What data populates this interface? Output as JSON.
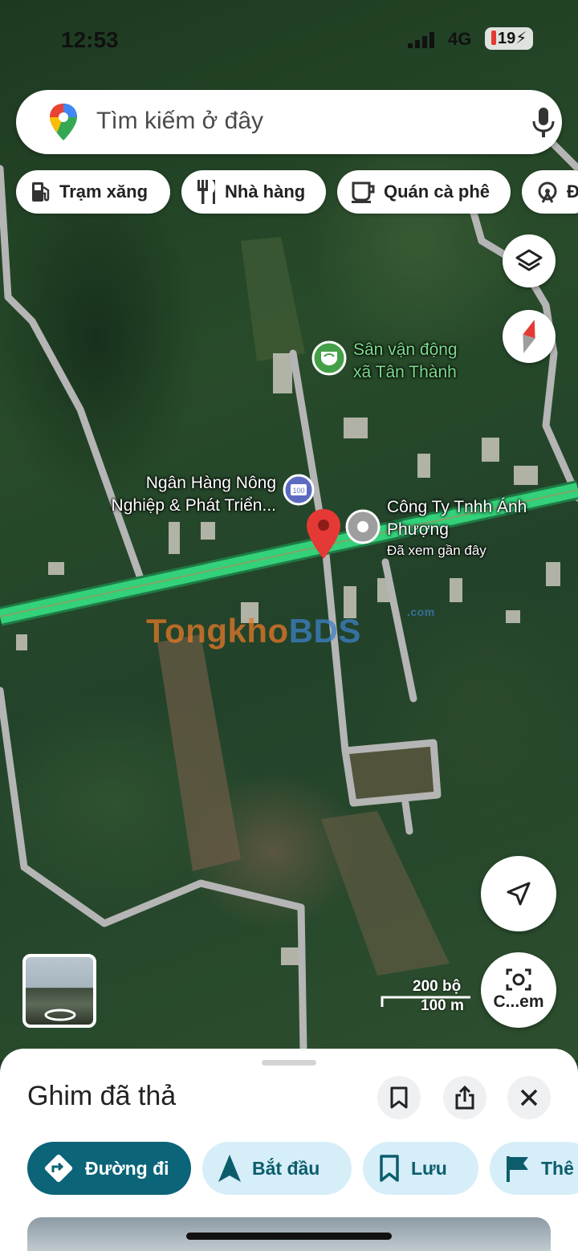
{
  "status_bar": {
    "time": "12:53",
    "network": "4G",
    "battery": "19"
  },
  "search": {
    "placeholder": "Tìm kiếm ở đây"
  },
  "chips": [
    {
      "label": "Trạm xăng",
      "icon": "gas-station-icon"
    },
    {
      "label": "Nhà hàng",
      "icon": "restaurant-icon"
    },
    {
      "label": "Quán cà phê",
      "icon": "coffee-icon"
    },
    {
      "label": "Đ",
      "icon": "attraction-icon"
    }
  ],
  "map": {
    "labels": {
      "stadium_line1": "Sân vận động",
      "stadium_line2": "xã Tân Thành",
      "bank_line1": "Ngân Hàng Nông",
      "bank_line2": "Nghiệp & Phát Triển...",
      "company_line1": "Công Ty Tnhh Ánh",
      "company_line2": "Phượng",
      "company_note": "Đã xem gần đây"
    },
    "watermark": {
      "part1": "Tongkho",
      "part2": "BDS",
      "suffix": ".com"
    },
    "scale": {
      "imperial": "200 bộ",
      "metric": "100 m"
    },
    "lens_label": "C...em",
    "colors": {
      "main_road": "#33d17a",
      "pin": "#e53935",
      "stadium": "#4caf50"
    }
  },
  "sheet": {
    "title": "Ghim đã thả",
    "actions": [
      {
        "label": "Đường đi",
        "icon": "directions-icon"
      },
      {
        "label": "Bắt đầu",
        "icon": "navigation-arrow-icon"
      },
      {
        "label": "Lưu",
        "icon": "bookmark-icon"
      },
      {
        "label": "Thê",
        "icon": "flag-icon"
      }
    ]
  }
}
